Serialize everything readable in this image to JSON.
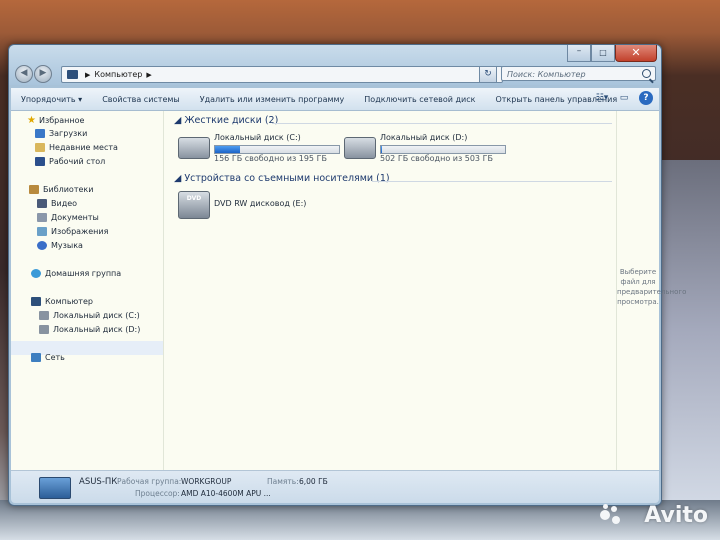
{
  "window": {
    "address": {
      "crumb": "Компьютер"
    },
    "search": {
      "placeholder": "Поиск: Компьютер"
    }
  },
  "toolbar": {
    "organize": "Упорядочить",
    "system_properties": "Свойства системы",
    "uninstall": "Удалить или изменить программу",
    "map_drive": "Подключить сетевой диск",
    "control_panel": "Открыть панель управления"
  },
  "sidebar": {
    "favorites": "Избранное",
    "downloads": "Загрузки",
    "recent": "Недавние места",
    "desktop": "Рабочий стол",
    "libraries": "Библиотеки",
    "video": "Видео",
    "documents": "Документы",
    "images": "Изображения",
    "music": "Музыка",
    "homegroup": "Домашняя группа",
    "computer": "Компьютер",
    "drive_c": "Локальный диск (C:)",
    "drive_d": "Локальный диск (D:)",
    "network": "Сеть"
  },
  "main": {
    "hard_drives_title": "Жесткие диски (2)",
    "removable_title": "Устройства со съемными носителями (1)",
    "drives": [
      {
        "name": "Локальный диск (C:)",
        "free": "156 ГБ свободно из 195 ГБ",
        "used_fraction": 0.2
      },
      {
        "name": "Локальный диск (D:)",
        "free": "502 ГБ свободно из 503 ГБ",
        "used_fraction": 0.002
      }
    ],
    "dvd": {
      "name": "DVD RW дисковод (E:)",
      "badge": "DVD"
    }
  },
  "preview": {
    "text": "Выберите файл для предварительного просмотра."
  },
  "details": {
    "pc_name": "ASUS-ПК",
    "workgroup_label": "Рабочая группа:",
    "workgroup_value": "WORKGROUP",
    "memory_label": "Память:",
    "memory_value": "6,00 ГБ",
    "cpu_label": "Процессор:",
    "cpu_value": "AMD A10-4600M APU ..."
  },
  "watermark": {
    "text": "Avito"
  }
}
